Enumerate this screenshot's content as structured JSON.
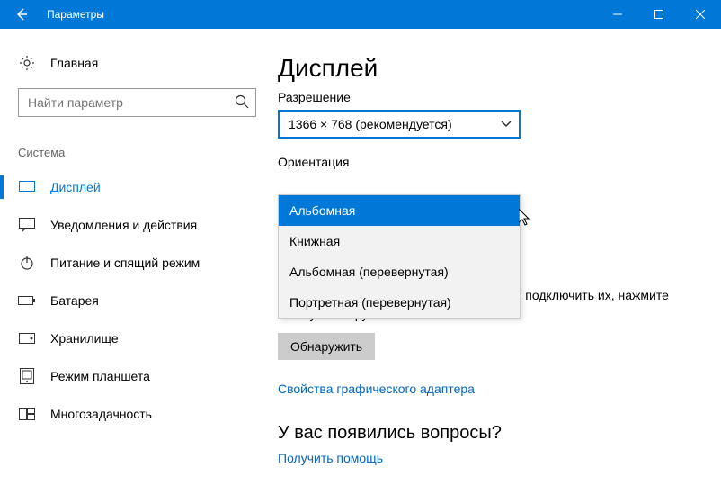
{
  "titlebar": {
    "title": "Параметры"
  },
  "sidebar": {
    "home": "Главная",
    "search_placeholder": "Найти параметр",
    "category": "Система",
    "items": [
      {
        "label": "Дисплей"
      },
      {
        "label": "Уведомления и действия"
      },
      {
        "label": "Питание и спящий режим"
      },
      {
        "label": "Батарея"
      },
      {
        "label": "Хранилище"
      },
      {
        "label": "Режим планшета"
      },
      {
        "label": "Многозадачность"
      }
    ]
  },
  "main": {
    "heading": "Дисплей",
    "resolution_label": "Разрешение",
    "resolution_value": "1366 × 768 (рекомендуется)",
    "orientation_label": "Ориентация",
    "orientation_options": [
      "Альбомная",
      "Книжная",
      "Альбомная (перевернутая)",
      "Портретная (перевернутая)"
    ],
    "multi_text_tail": "чаться автоматически. Чтобы попытаться подключить их, нажмите кнопку \"Обнаружить\".",
    "detect_btn": "Обнаружить",
    "adapter_link": "Свойства графического адаптера",
    "help_heading": "У вас появились вопросы?",
    "help_link": "Получить помощь"
  }
}
